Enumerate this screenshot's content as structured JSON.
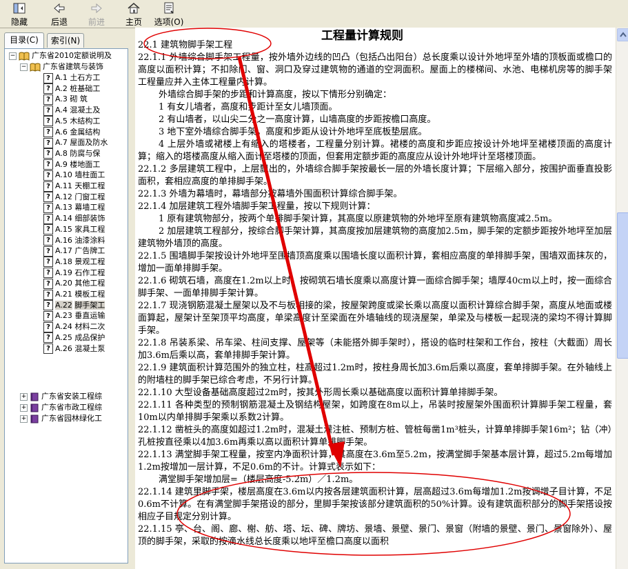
{
  "toolbar": {
    "hide": "隐藏",
    "back": "后退",
    "forward": "前进",
    "home": "主页",
    "options": "选项(O)"
  },
  "tabs": {
    "contents": "目录(C)",
    "index": "索引(N)"
  },
  "tree": {
    "root": "广东省2010定额说明及",
    "child": "广东省建筑与装饰",
    "items": [
      {
        "code": "A.1",
        "label": "土石方工"
      },
      {
        "code": "A.2",
        "label": "桩基础工"
      },
      {
        "code": "A.3",
        "label": "砌  筑"
      },
      {
        "code": "A.4",
        "label": "混凝土及"
      },
      {
        "code": "A.5",
        "label": "木结构工"
      },
      {
        "code": "A.6",
        "label": "金属结构"
      },
      {
        "code": "A.7",
        "label": "屋面及防水"
      },
      {
        "code": "A.8",
        "label": "防腐与保"
      },
      {
        "code": "A.9",
        "label": "楼地面工"
      },
      {
        "code": "A.10",
        "label": "墙柱面工"
      },
      {
        "code": "A.11",
        "label": "天棚工程"
      },
      {
        "code": "A.12",
        "label": "门窗工程"
      },
      {
        "code": "A.13",
        "label": "幕墙工程"
      },
      {
        "code": "A.14",
        "label": "细部装饰"
      },
      {
        "code": "A.15",
        "label": "家具工程"
      },
      {
        "code": "A.16",
        "label": "油漆涂料"
      },
      {
        "code": "A.17",
        "label": "广告牌工"
      },
      {
        "code": "A.18",
        "label": "景观工程"
      },
      {
        "code": "A.19",
        "label": "石作工程"
      },
      {
        "code": "A.20",
        "label": "其他工程"
      },
      {
        "code": "A.21",
        "label": "模板工程"
      },
      {
        "code": "A.22",
        "label": "脚手架工"
      },
      {
        "code": "A.23",
        "label": "垂直运输"
      },
      {
        "code": "A.24",
        "label": "材料二次"
      },
      {
        "code": "A.25",
        "label": "成品保护"
      },
      {
        "code": "A.26",
        "label": "混凝土泵"
      }
    ],
    "others": [
      "广东省安装工程综",
      "广东省市政工程综",
      "广东省园林绿化工"
    ]
  },
  "content": {
    "heading": "工程量计算规则",
    "paragraphs": [
      "22.1  建筑物脚手架工程",
      "22.1.1  外墙综合脚手架工程量，按外墙外边线的凹凸（包括凸出阳台）总长度乘以设计外地坪至外墙的顶板面或檐口的高度以面积计算；不扣除门、窗、洞口及穿过建筑物的通道的空洞面积。屋面上的楼梯间、水池、电梯机房等的脚手架工程量应并入主体工程量内计算。",
      "外墙综合脚手架的步距和计算高度，按以下情形分别确定：",
      "1  有女儿墙者，高度和步距计至女儿墙顶面。",
      "2  有山墙者，以山尖二分之一高度计算，山墙高度的步距按檐口高度。",
      "3  地下室外墙综合脚手架，高度和步距从设计外地坪至底板垫层底。",
      "4  上层外墙或裙楼上有缩入的塔楼者，工程量分别计算。裙楼的高度和步距应按设计外地坪至裙楼顶面的高度计算；缩入的塔楼高度从缩入面计至塔楼的顶面，但套用定额步距的高度应从设计外地坪计至塔楼顶面。",
      "22.1.2  多层建筑工程中，上层飘出的，外墙综合脚手架按最长一层的外墙长度计算；下层缩入部分，按围护面垂直投影面积，套相应高度的单排脚手架。",
      "22.1.3  外墙为幕墙时，幕墙部分按幕墙外围面积计算综合脚手架。",
      "22.1.4  加层建筑工程外墙脚手架工程量，按以下规则计算：",
      "1  原有建筑物部分，按两个单排脚手架计算，其高度以原建筑物的外地坪至原有建筑物高度减2.5m。",
      "2  加层建筑工程部分，按综合脚手架计算，其高度按加层建筑物的高度加2.5m，脚手架的定额步距按外地坪至加层建筑物外墙顶的高度。",
      "22.1.5  围墙脚手架按设计外地坪至围墙顶高度乘以围墙长度以面积计算，套相应高度的单排脚手架，围墙双面抹灰的，增加一面单排脚手架。",
      "22.1.6  砌筑石墙，高度在1.2m以上时，按砌筑石墙长度乘以高度计算一面综合脚手架；墙厚40cm以上时，按一面综合脚手架、一面单排脚手架计算。",
      "22.1.7  现浇钢筋混凝土屋架以及不与板相接的梁，按屋架跨度或梁长乘以高度以面积计算综合脚手架，高度从地面或楼面算起，屋架计至架顶平均高度，单梁高度计至梁面在外墙轴线的现浇屋架，单梁及与楼板一起现浇的梁均不得计算脚手架。",
      "22.1.8  吊装系梁、吊车梁、柱间支撑、屋架等（未能搭外脚手架时），搭设的临时柱架和工作台，按柱（大截面）周长加3.6m后乘以高，套单排脚手架计算。",
      "22.1.9  建筑面积计算范围外的独立柱，柱高超过1.2m时，按柱身周长加3.6m后乘以高度，套单排脚手架。在外轴线上的附墙柱的脚手架已综合考虑，不另行计算。",
      "22.1.10  大型设备基础高度超过2m时，按其外形周长乘以基础高度以面积计算单排脚手架。",
      "22.1.11  各种类型的预制钢筋混凝土及钢结构屋架，如跨度在8m以上，吊装时按屋架外围面积计算脚手架工程量，套10m以内单排脚手架乘以系数2计算。",
      "22.1.12  凿桩头的高度如超过1.2m时，混凝土灌注桩、预制方桩、管桩每凿1m³桩头，计算单排脚手架16m²；钻（冲）孔桩按直径乘以4加3.6m再乘以高以面积计算单排脚手架。",
      "22.1.13  满堂脚手架工程量，按室内净面积计算，其高度在3.6m至5.2m，按满堂脚手架基本层计算，超过5.2m每增加1.2m按增加一层计算，不足0.6m的不计。计算式表示如下：",
      "满堂脚手架增加层=（楼层高度-5.2m）／1.2m。",
      "22.1.14  建筑里脚手架，楼层高度在3.6m以内按各层建筑面积计算，层高超过3.6m每增加1.2m按调增子目计算，不足0.6m不计算。在有满堂脚手架搭设的部分，里脚手架按该部分建筑面积的50%计算。设有建筑面积部分的脚手架搭设按相应子目规定分别计算。",
      "22.1.15  亭、台、阁、廊、榭、舫、塔、坛、碑、牌坊、景墙、景壁、景门、景窗（附墙的景壁、景门、景窗除外）、屋顶的脚手架，采取的按滴水线总长度乘以地坪至檐口高度以面积"
    ]
  },
  "annotation_color": "#e00000"
}
